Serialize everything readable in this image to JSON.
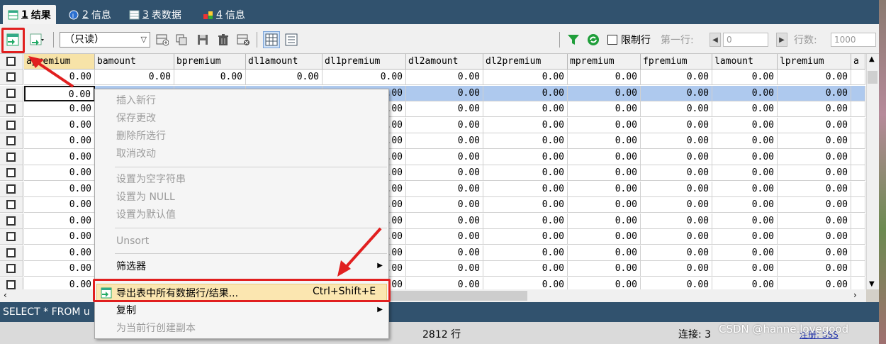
{
  "tabs": [
    {
      "num": "1",
      "label": "结果",
      "active": true
    },
    {
      "num": "2",
      "label": "信息",
      "active": false
    },
    {
      "num": "3",
      "label": "表数据",
      "active": false
    },
    {
      "num": "4",
      "label": "信息",
      "active": false
    }
  ],
  "toolbar": {
    "mode_value": "（只读）",
    "limit_rows_label": "限制行",
    "first_row_label": "第一行:",
    "first_row_value": "0",
    "row_count_label": "行数:",
    "row_count_value": "1000"
  },
  "grid": {
    "columns": [
      "apremium",
      "bamount",
      "bpremium",
      "dl1amount",
      "dl1premium",
      "dl2amount",
      "dl2premium",
      "mpremium",
      "fpremium",
      "lamount",
      "lpremium",
      "a"
    ],
    "first_row": [
      "0.00",
      "0.00",
      "0.00",
      "0.00",
      "0.00",
      "0.00",
      "0.00",
      "0.00",
      "0.00",
      "0.00",
      "0.00"
    ],
    "cell_value": "0.00",
    "visible_fragment": ".00"
  },
  "context_menu": {
    "items": [
      {
        "label": "插入新行",
        "disabled": true
      },
      {
        "label": "保存更改",
        "disabled": true
      },
      {
        "label": "删除所选行",
        "disabled": true
      },
      {
        "label": "取消改动",
        "disabled": true
      },
      {
        "label": "设置为空字符串",
        "disabled": true
      },
      {
        "label": "设置为 NULL",
        "disabled": true
      },
      {
        "label": "设置为默认值",
        "disabled": true
      },
      {
        "label": "Unsort",
        "disabled": true
      },
      {
        "label": "筛选器",
        "disabled": false,
        "submenu": true
      },
      {
        "label": "导出表中所有数据行/结果...",
        "disabled": false,
        "shortcut": "Ctrl+Shift+E"
      },
      {
        "label": "复制",
        "disabled": false,
        "submenu": true
      },
      {
        "label": "为当前行创建副本",
        "disabled": true
      }
    ]
  },
  "query_text": "SELECT * FROM u",
  "status": {
    "row_count": "2812 行",
    "connection": "连接: 3",
    "register": "注册: SSS",
    "watermark": "CSDN @hanne.lovegood"
  },
  "colors": {
    "tab_bar": "#31526e",
    "selection": "#aec9ee",
    "annotation": "#e11f1f"
  }
}
